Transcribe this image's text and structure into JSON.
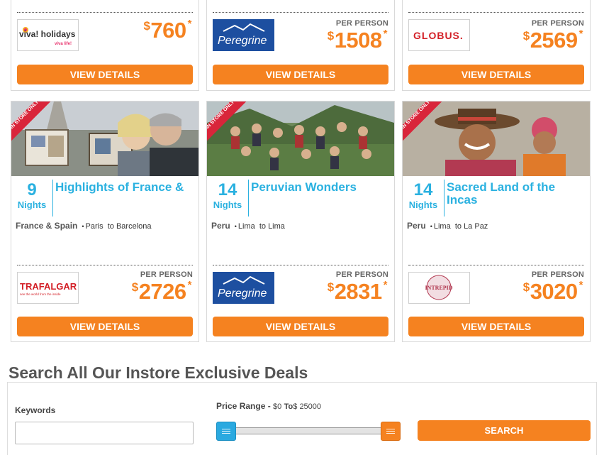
{
  "top_cards": [
    {
      "logo": "viva! holidays",
      "logo_sub": "viva life!",
      "per_person": "",
      "currency": "$",
      "price": "760",
      "asterisk": "*",
      "button": "VIEW DETAILS"
    },
    {
      "logo": "Peregrine",
      "per_person": "PER PERSON",
      "currency": "$",
      "price": "1508",
      "asterisk": "*",
      "button": "VIEW DETAILS"
    },
    {
      "logo": "GLOBUS.",
      "per_person": "PER PERSON",
      "currency": "$",
      "price": "2569",
      "asterisk": "*",
      "button": "VIEW DETAILS"
    }
  ],
  "bottom_cards": [
    {
      "badge": "IN STORE ONLY",
      "nights": "9",
      "nights_label": "Nights",
      "title": "Highlights of France &",
      "country": "France & Spain",
      "bullet": "•",
      "from": "Paris",
      "to_word": "to",
      "to": "Barcelona",
      "logo": "TRAFALGAR",
      "logo_sub": "see the world from the inside",
      "per_person": "PER PERSON",
      "currency": "$",
      "price": "2726",
      "asterisk": "*",
      "button": "VIEW DETAILS"
    },
    {
      "badge": "IN STORE ONLY",
      "nights": "14",
      "nights_label": "Nights",
      "title": "Peruvian Wonders",
      "country": "Peru",
      "bullet": "•",
      "from": "Lima",
      "to_word": "to",
      "to": "Lima",
      "logo": "Peregrine",
      "per_person": "PER PERSON",
      "currency": "$",
      "price": "2831",
      "asterisk": "*",
      "button": "VIEW DETAILS"
    },
    {
      "badge": "IN STORE ONLY",
      "nights": "14",
      "nights_label": "Nights",
      "title": "Sacred Land of the Incas",
      "country": "Peru",
      "bullet": "•",
      "from": "Lima",
      "to_word": "to",
      "to": "La Paz",
      "logo": "INTREPID",
      "per_person": "PER PERSON",
      "currency": "$",
      "price": "3020",
      "asterisk": "*",
      "button": "VIEW DETAILS"
    }
  ],
  "search": {
    "heading": "Search All Our Instore Exclusive Deals",
    "keywords_label": "Keywords",
    "keywords_value": "",
    "price_range_label": "Price Range -",
    "min_value": "$0",
    "to_label": "To",
    "max_value": "$ 25000",
    "button": "SEARCH"
  },
  "colors": {
    "accent": "#f58220",
    "blue": "#2ab1e0",
    "ribbon": "#d9253a"
  }
}
